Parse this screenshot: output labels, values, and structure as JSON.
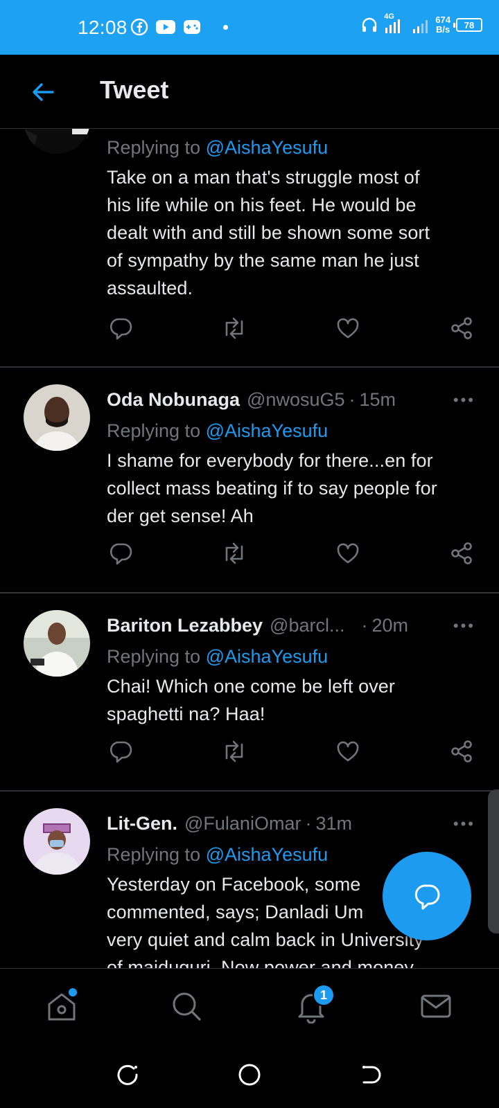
{
  "status_bar": {
    "time": "12:08",
    "network": "4G",
    "speed_value": "674",
    "speed_unit": "B/s",
    "battery": "78"
  },
  "header": {
    "title": "Tweet"
  },
  "tweets": [
    {
      "replying_prefix": "Replying to",
      "mention": "@AishaYesufu",
      "lines": [
        "Take on a man that's struggle most of",
        "his life while on his feet.  He would be",
        "dealt with and still be shown some sort",
        "of sympathy by the same man he just",
        "assaulted."
      ]
    },
    {
      "name": "Oda Nobunaga",
      "handle": "@nwosuG5",
      "separator": "·",
      "time": "15m",
      "replying_prefix": "Replying to",
      "mention": "@AishaYesufu",
      "lines": [
        "I shame for everybody for there...en for",
        "collect mass beating if to say people for",
        "der get sense! Ah"
      ]
    },
    {
      "name": "Bariton Lezabbey",
      "handle": "@barcl...",
      "separator": "·",
      "time": "20m",
      "replying_prefix": "Replying to",
      "mention": "@AishaYesufu",
      "lines": [
        "Chai! Which one come be left over",
        "spaghetti na? Haa!"
      ]
    },
    {
      "name": "Lit-Gen.",
      "handle": "@FulaniOmar",
      "separator": "·",
      "time": "31m",
      "replying_prefix": "Replying to",
      "mention": "@AishaYesufu",
      "lines": [
        "Yesterday on Facebook, some",
        "commented, says; Danladi Um",
        "very quiet and calm back in University",
        "of maiduguri. Now power and money"
      ]
    }
  ],
  "more_label": "•••",
  "bottom_nav": {
    "notification_count": "1"
  },
  "colors": {
    "accent": "#1d9bf0",
    "status_bar": "#1da1f2",
    "background": "#000000",
    "muted_text": "#71767b",
    "divider": "#2f3336"
  },
  "icons": {
    "status_left": [
      "facebook-icon",
      "youtube-icon",
      "game-icon"
    ],
    "status_right": [
      "headset-icon",
      "signal-icon",
      "battery-icon"
    ],
    "header": "back-arrow-icon",
    "actions": [
      "reply-icon",
      "retweet-icon",
      "like-icon",
      "share-icon"
    ],
    "fab": "compose-reply-icon",
    "bottom_nav": [
      "home-icon",
      "search-icon",
      "notifications-icon",
      "messages-icon"
    ],
    "system_nav": [
      "recents-icon",
      "home-circle-icon",
      "back-icon"
    ]
  }
}
